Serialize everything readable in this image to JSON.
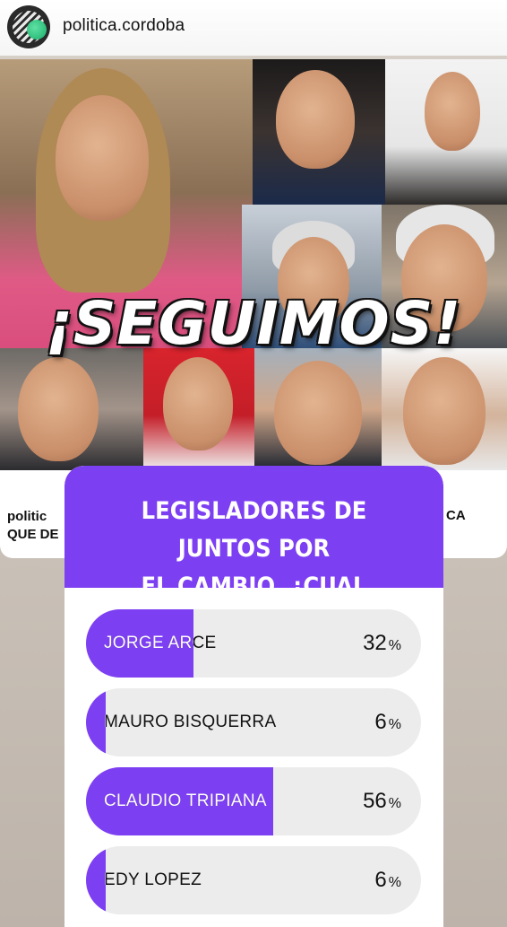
{
  "header": {
    "account_name": "politica.cordoba"
  },
  "post": {
    "headline": "¡SEGUIMOS!",
    "caption_left_line1": "politic",
    "caption_left_line2": "QUE DE",
    "caption_right": "CA"
  },
  "poll": {
    "question_line1": "LEGISLADORES DE JUNTOS POR",
    "question_line2": "EL CAMBIO, ¿CUAL PREFERÍS?",
    "accent_color": "#7d3ff2",
    "options": [
      {
        "label": "JORGE ARCE",
        "percent": 32,
        "percent_text": "32"
      },
      {
        "label": "MAURO BISQUERRA",
        "percent": 6,
        "percent_text": "6"
      },
      {
        "label": "CLAUDIO TRIPIANA",
        "percent": 56,
        "percent_text": "56"
      },
      {
        "label": "EDY LOPEZ",
        "percent": 6,
        "percent_text": "6"
      }
    ],
    "percent_sign": "%"
  }
}
